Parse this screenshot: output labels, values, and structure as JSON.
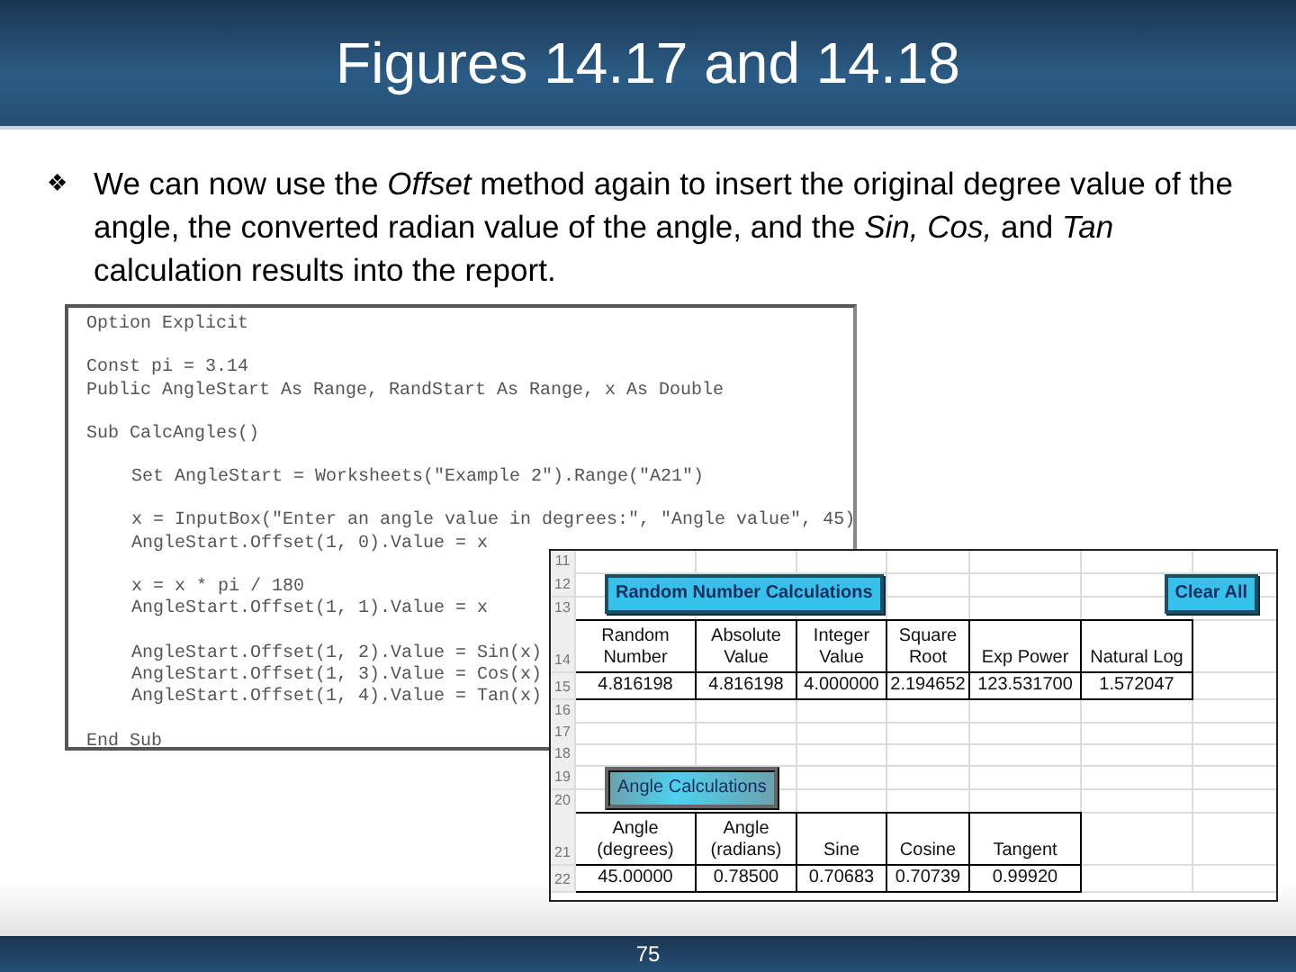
{
  "slide": {
    "title": "Figures 14.17 and 14.18",
    "bullet_symbol": "❖",
    "bullet": "We can now use the *Offset* method again to insert the original degree value of the angle, the converted radian value of the angle, and the *Sin,* *Cos,* and *Tan* calculation results into the report.",
    "page_number": "75"
  },
  "code_blocks": [
    {
      "indented": false,
      "lines": [
        "Option Explicit"
      ]
    },
    {
      "indented": false,
      "lines": [
        "Const pi = 3.14",
        "Public AngleStart As Range, RandStart As Range, x As Double"
      ]
    },
    {
      "indented": false,
      "lines": [
        "Sub CalcAngles()"
      ]
    },
    {
      "indented": true,
      "lines": [
        "Set AngleStart = Worksheets(\"Example 2\").Range(\"A21\")"
      ]
    },
    {
      "indented": true,
      "lines": [
        "x = InputBox(\"Enter an angle value in degrees:\", \"Angle value\", 45)",
        "AngleStart.Offset(1, 0).Value = x"
      ]
    },
    {
      "indented": true,
      "lines": [
        "x = x * pi / 180",
        "AngleStart.Offset(1, 1).Value = x"
      ]
    },
    {
      "indented": true,
      "lines": [
        "AngleStart.Offset(1, 2).Value = Sin(x)",
        "AngleStart.Offset(1, 3).Value = Cos(x)",
        "AngleStart.Offset(1, 4).Value = Tan(x)"
      ]
    },
    {
      "indented": false,
      "lines": [
        "End Sub"
      ]
    }
  ],
  "sheet": {
    "rows": [
      {
        "number": "11",
        "kind": "empty"
      },
      {
        "number": "12",
        "kind": "button",
        "buttons": [
          {
            "label": "Random Number Calculations",
            "kind": "cyan"
          },
          {
            "label": "Clear All",
            "kind": "cyan"
          }
        ]
      },
      {
        "number": "13",
        "kind": "empty"
      },
      {
        "number": "14",
        "kind": "header",
        "cells": [
          {
            "lines": [
              "Random",
              "Number"
            ]
          },
          {
            "lines": [
              "Absolute",
              "Value"
            ]
          },
          {
            "lines": [
              "Integer",
              "Value"
            ]
          },
          {
            "lines": [
              "Square",
              "Root"
            ]
          },
          {
            "lines": [
              "Exp Power"
            ]
          },
          {
            "lines": [
              "Natural Log"
            ]
          }
        ]
      },
      {
        "number": "15",
        "kind": "data",
        "cells": [
          "4.816198",
          "4.816198",
          "4.000000",
          "2.194652",
          "123.531700",
          "1.572047"
        ]
      },
      {
        "number": "16",
        "kind": "empty"
      },
      {
        "number": "17",
        "kind": "empty"
      },
      {
        "number": "18",
        "kind": "empty"
      },
      {
        "number": "19",
        "kind": "button",
        "buttons": [
          {
            "label": "Angle Calculations",
            "kind": "framed"
          }
        ]
      },
      {
        "number": "20",
        "kind": "empty"
      },
      {
        "number": "21",
        "kind": "header",
        "cells": [
          {
            "lines": [
              "Angle",
              "(degrees)"
            ]
          },
          {
            "lines": [
              "Angle",
              "(radians)"
            ]
          },
          {
            "lines": [
              "Sine"
            ]
          },
          {
            "lines": [
              "Cosine"
            ]
          },
          {
            "lines": [
              "Tangent"
            ]
          }
        ]
      },
      {
        "number": "22",
        "kind": "data",
        "cells": [
          "45.00000",
          "0.78500",
          "0.70683",
          "0.70739",
          "0.99920"
        ]
      }
    ]
  }
}
